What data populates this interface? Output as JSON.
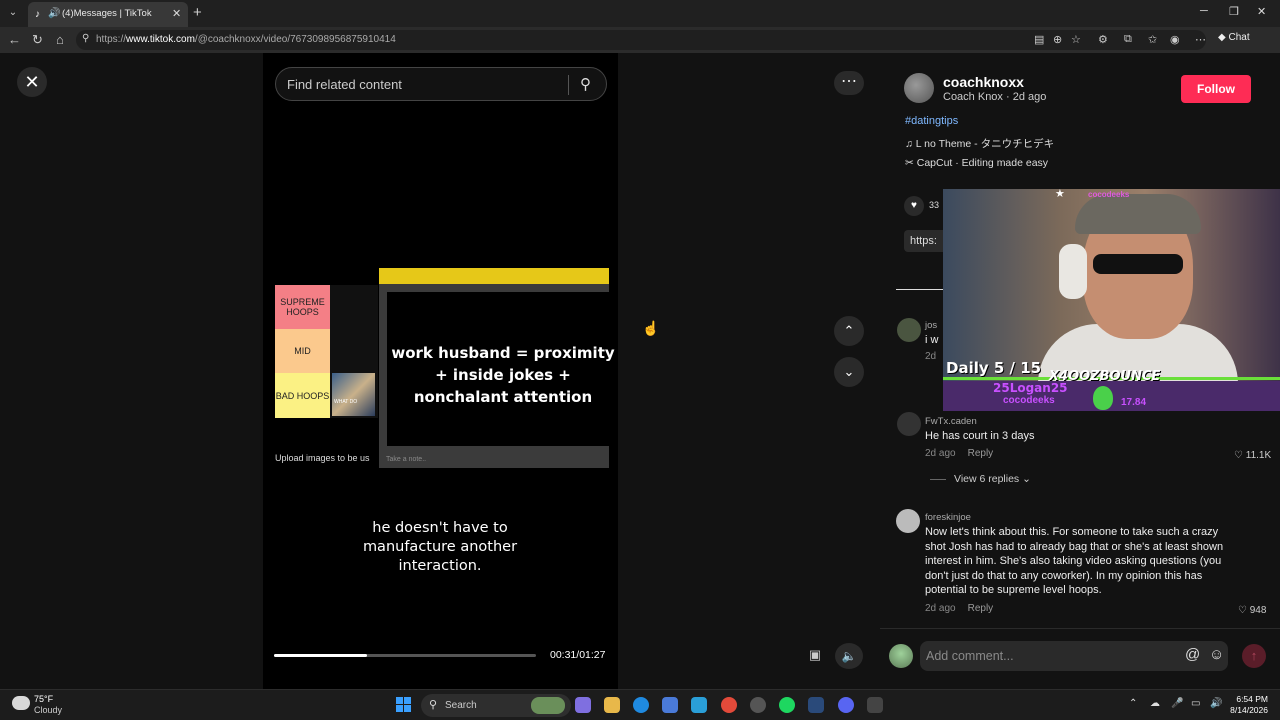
{
  "browser": {
    "tab_title": "(4)Messages | TikTok",
    "url_prefix": "https://",
    "url_domain": "www.tiktok.com",
    "url_path": "/@coachknoxx/video/7673098956875910414",
    "chat_label": "Chat"
  },
  "video": {
    "search_placeholder": "Find related content",
    "tier_labels": [
      "SUPREME HOOPS",
      "MID",
      "BAD HOOPS"
    ],
    "tier_colors": [
      "#f47f86",
      "#fbc98d",
      "#fbf184"
    ],
    "note_text": "work husband = proximity + inside jokes + nonchalant attention",
    "take_note": "Take a note..",
    "upload_text": "Upload images to be us",
    "thumb_text": "WHAT DO",
    "caption": "he doesn't have to manufacture another interaction.",
    "time": "00:31/01:27",
    "progress": 0.356
  },
  "author": {
    "username": "coachknoxx",
    "subline": "Coach Knox · 2d ago",
    "follow_label": "Follow",
    "hashtag": "#datingtips",
    "music": "L no Theme - タニウチヒデキ",
    "capcut": "CapCut · Editing made easy",
    "like_count": "33",
    "link_pill": "https:"
  },
  "overlay": {
    "top_name": "cocodeeks",
    "daily": "Daily 5 / 15",
    "brand": "X4OOZBOUNCE",
    "logan": "25Logan25",
    "coco": "cocodeeks",
    "num": "17.84"
  },
  "comments": [
    {
      "user": "jos",
      "text": "i w",
      "meta": "2d"
    },
    {
      "user": "FwTx.caden",
      "text": "He has court in 3 days",
      "meta": "2d ago",
      "reply": "Reply",
      "likes": "11.1K"
    },
    {
      "user": "foreskinjoe",
      "text": "Now let's think about this. For someone to take such a crazy shot Josh has had to already bag that or she's at least shown interest in him. She's also taking video asking questions (you don't just do that to any coworker). In my opinion this has potential to be supreme level hoops.",
      "meta": "2d ago",
      "reply": "Reply",
      "likes": "948"
    }
  ],
  "view_replies": "View 6 replies",
  "comment_input": {
    "placeholder": "Add comment..."
  },
  "taskbar": {
    "temp": "75°F",
    "condition": "Cloudy",
    "search_label": "Search",
    "time": "6:54 PM",
    "date": "8/14/2026"
  },
  "colors": {
    "follow": "#fe2c55",
    "hashtag": "#7fb8ff"
  }
}
